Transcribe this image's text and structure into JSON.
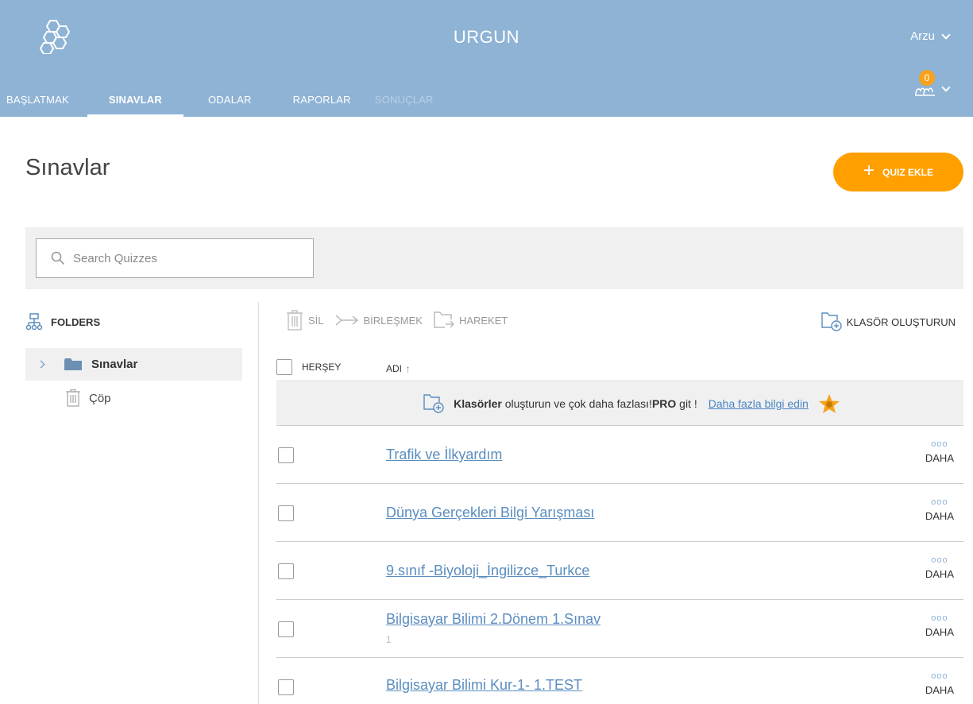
{
  "header": {
    "app_title": "URGUN",
    "user_name": "Arzu",
    "notification_count": "0",
    "nav_tabs": [
      {
        "label": "BAŞLATMAK"
      },
      {
        "label": "SINAVLAR"
      },
      {
        "label": "ODALAR"
      },
      {
        "label": "RAPORLAR"
      },
      {
        "label": "SONUÇLAR"
      }
    ],
    "active_tab": "SINAVLAR",
    "disabled_tab": "SONUÇLAR"
  },
  "page": {
    "title": "Sınavlar",
    "add_quiz_label": "QUIZ EKLE"
  },
  "search": {
    "placeholder": "Search Quizzes",
    "value": ""
  },
  "sidebar": {
    "heading": "FOLDERS",
    "folder_label": "Sınavlar",
    "trash_label": "Çöp"
  },
  "toolbar": {
    "delete_label": "SİL",
    "merge_label": "BİRLEŞMEK",
    "move_label": "HAREKET",
    "create_folder_label": "KLASÖR OLUŞTURUN"
  },
  "list": {
    "select_all_label": "HERŞEY",
    "name_column_label": "ADI",
    "sort_arrow": "↑",
    "promo": {
      "bold_word": "Klasörler",
      "text": " oluşturun ve çok daha fazlası!",
      "pro": "PRO",
      "text2": " git !",
      "link": "Daha fazla bilgi edin"
    },
    "more_label": "DAHA",
    "more_dots": "ooo",
    "items": [
      {
        "name": "Trafik ve İlkyardım",
        "sub": ""
      },
      {
        "name": "Dünya Gerçekleri Bilgi Yarışması",
        "sub": ""
      },
      {
        "name": "9.sınıf -Biyoloji_İngilizce_Turkce",
        "sub": ""
      },
      {
        "name": "Bilgisayar Bilimi 2.Dönem 1.Sınav",
        "sub": "1"
      },
      {
        "name": "Bilgisayar Bilimi Kur-1- 1.TEST",
        "sub": ""
      }
    ]
  },
  "colors": {
    "header_bg": "#8eb3d5",
    "accent_orange": "#ffa000",
    "link_blue": "#5a8dbf",
    "panel_gray": "#f0f0f0"
  }
}
